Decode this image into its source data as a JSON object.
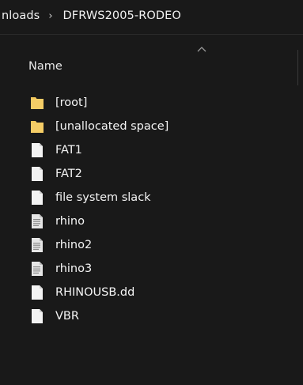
{
  "breadcrumb": {
    "parent": "nloads",
    "separator": "›",
    "current": "DFRWS2005-RODEO"
  },
  "header": {
    "name_column": "Name",
    "sort_direction": "ascending"
  },
  "colors": {
    "background": "#191919",
    "folder": "#f2c75c",
    "file_page": "#f3f3f3",
    "text": "#f4f4f4"
  },
  "files": [
    {
      "name": "[root]",
      "icon": "folder-icon"
    },
    {
      "name": "[unallocated space]",
      "icon": "folder-icon"
    },
    {
      "name": "FAT1",
      "icon": "blank-file-icon"
    },
    {
      "name": "FAT2",
      "icon": "blank-file-icon"
    },
    {
      "name": "file system slack",
      "icon": "blank-file-icon"
    },
    {
      "name": "rhino",
      "icon": "text-file-icon"
    },
    {
      "name": "rhino2",
      "icon": "text-file-icon"
    },
    {
      "name": "rhino3",
      "icon": "text-file-icon"
    },
    {
      "name": "RHINOUSB.dd",
      "icon": "blank-file-icon"
    },
    {
      "name": "VBR",
      "icon": "blank-file-icon"
    }
  ]
}
